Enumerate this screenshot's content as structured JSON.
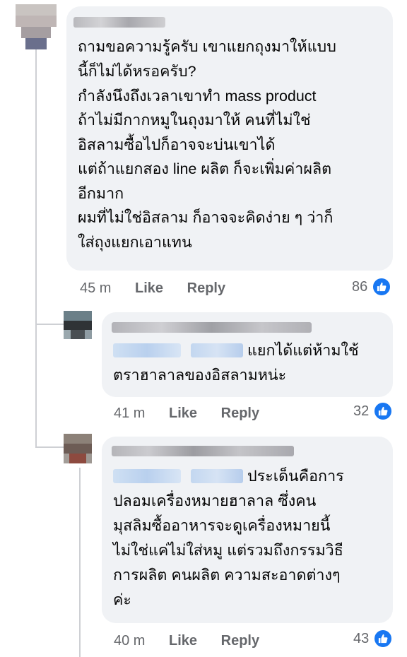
{
  "comments": [
    {
      "id": "main",
      "text_lines": [
        "ถามขอความรู้ครับ เขาแยกถุงมาให้แบบ",
        "นี้ก็ไม่ได้หรอครับ?",
        "กำลังนึงถึงเวลาเขาทำ mass product",
        "ถ้าไม่มีกากหมูในถุงมาให้ คนที่ไม่ใช่",
        "อิสลามซื้อไปก็อาจจะบ่นเขาได้",
        "แต่ถ้าแยกสอง line ผลิต ก็จะเพิ่มค่าผลิต",
        "อีกมาก",
        "ผมที่ไม่ใช่อิสลาม ก็อาจจะคิดง่าย ๆ ว่าก็",
        "ใส่ถุงแยกเอาแทน"
      ],
      "time": "45 m",
      "like_label": "Like",
      "reply_label": "Reply",
      "reactions": "86"
    },
    {
      "id": "reply1",
      "text_lines": [
        "แยกได้แต่ห้ามใช้",
        "ตราฮาลาลของอิสลามหน่ะ"
      ],
      "time": "41 m",
      "like_label": "Like",
      "reply_label": "Reply",
      "reactions": "32"
    },
    {
      "id": "reply2",
      "text_lines": [
        "ประเด็นคือการ",
        "ปลอมเครื่องหมายฮาลาล ซึ่งคน",
        "มุสลิมซื้ออาหารจะดูเครื่องหมายนี้",
        "ไม่ใช่แค่ไม่ใส่หมู แต่รวมถึงกรรมวิธี",
        "การผลิต คนผลิต ความสะอาดต่างๆ",
        "ค่ะ"
      ],
      "time": "40 m",
      "like_label": "Like",
      "reply_label": "Reply",
      "reactions": "43"
    }
  ],
  "icons": {
    "like": "thumbs-up-icon"
  },
  "colors": {
    "bubble": "#f0f2f5",
    "meta": "#65676b",
    "like_blue": "#1877f2",
    "thread_line": "#ced0d4"
  }
}
